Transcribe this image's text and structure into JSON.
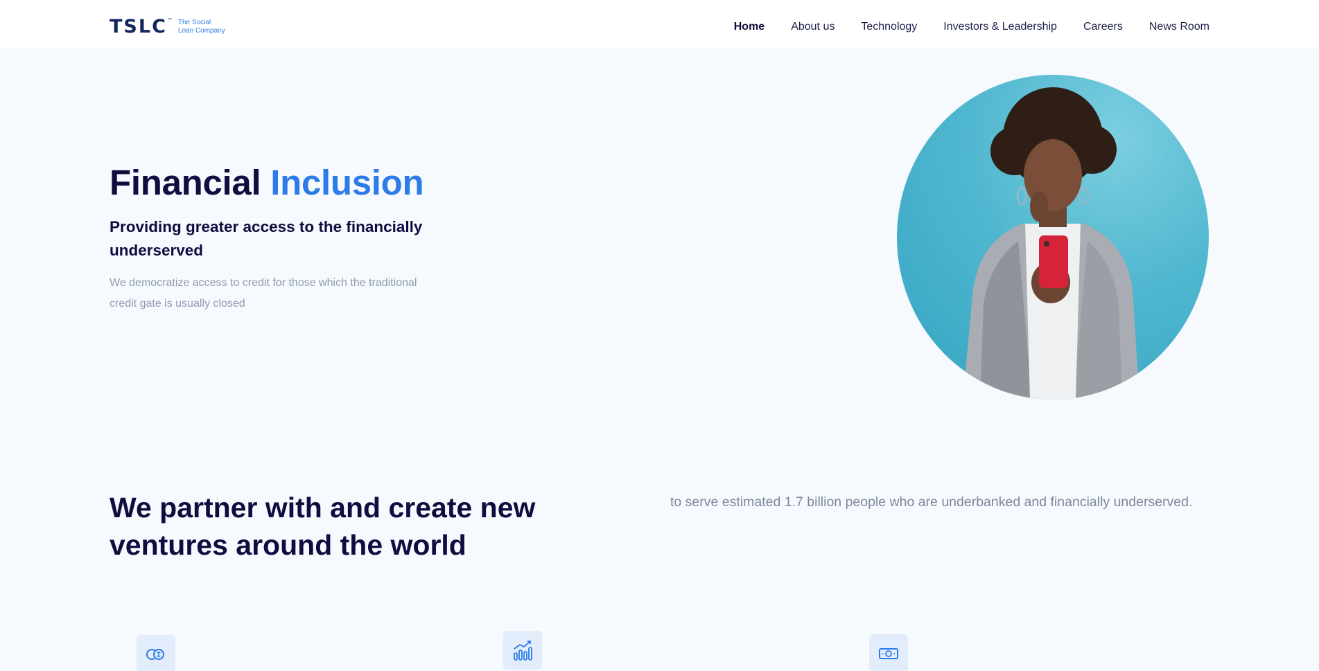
{
  "header": {
    "logo": {
      "mark": "TSLC",
      "tm": "™",
      "sub_line1": "The Social",
      "sub_line2": "Loan Company"
    },
    "nav": [
      {
        "label": "Home",
        "active": true
      },
      {
        "label": "About us"
      },
      {
        "label": "Technology"
      },
      {
        "label": "Investors & Leadership"
      },
      {
        "label": "Careers"
      },
      {
        "label": "News Room"
      }
    ]
  },
  "hero": {
    "title_part1": "Financial",
    "title_part2": "Inclusion",
    "subtitle": "Providing greater access to the financially underserved",
    "description": "We democratize access to credit for those which the traditional credit gate is usually closed",
    "image": "woman-looking-at-red-phone-photo"
  },
  "partner": {
    "title": "We partner with and create new ventures around the world",
    "text": "to serve estimated 1.7 billion people who are underbanked and financially underserved."
  },
  "features": [
    {
      "icon": "coins-icon"
    },
    {
      "icon": "growth-chart-icon"
    },
    {
      "icon": "banknote-icon"
    }
  ],
  "colors": {
    "brand_navy": "#0f0c3f",
    "accent_blue": "#2c7be8",
    "background": "#f6f9fd",
    "icon_tile": "#e2ecfb"
  }
}
